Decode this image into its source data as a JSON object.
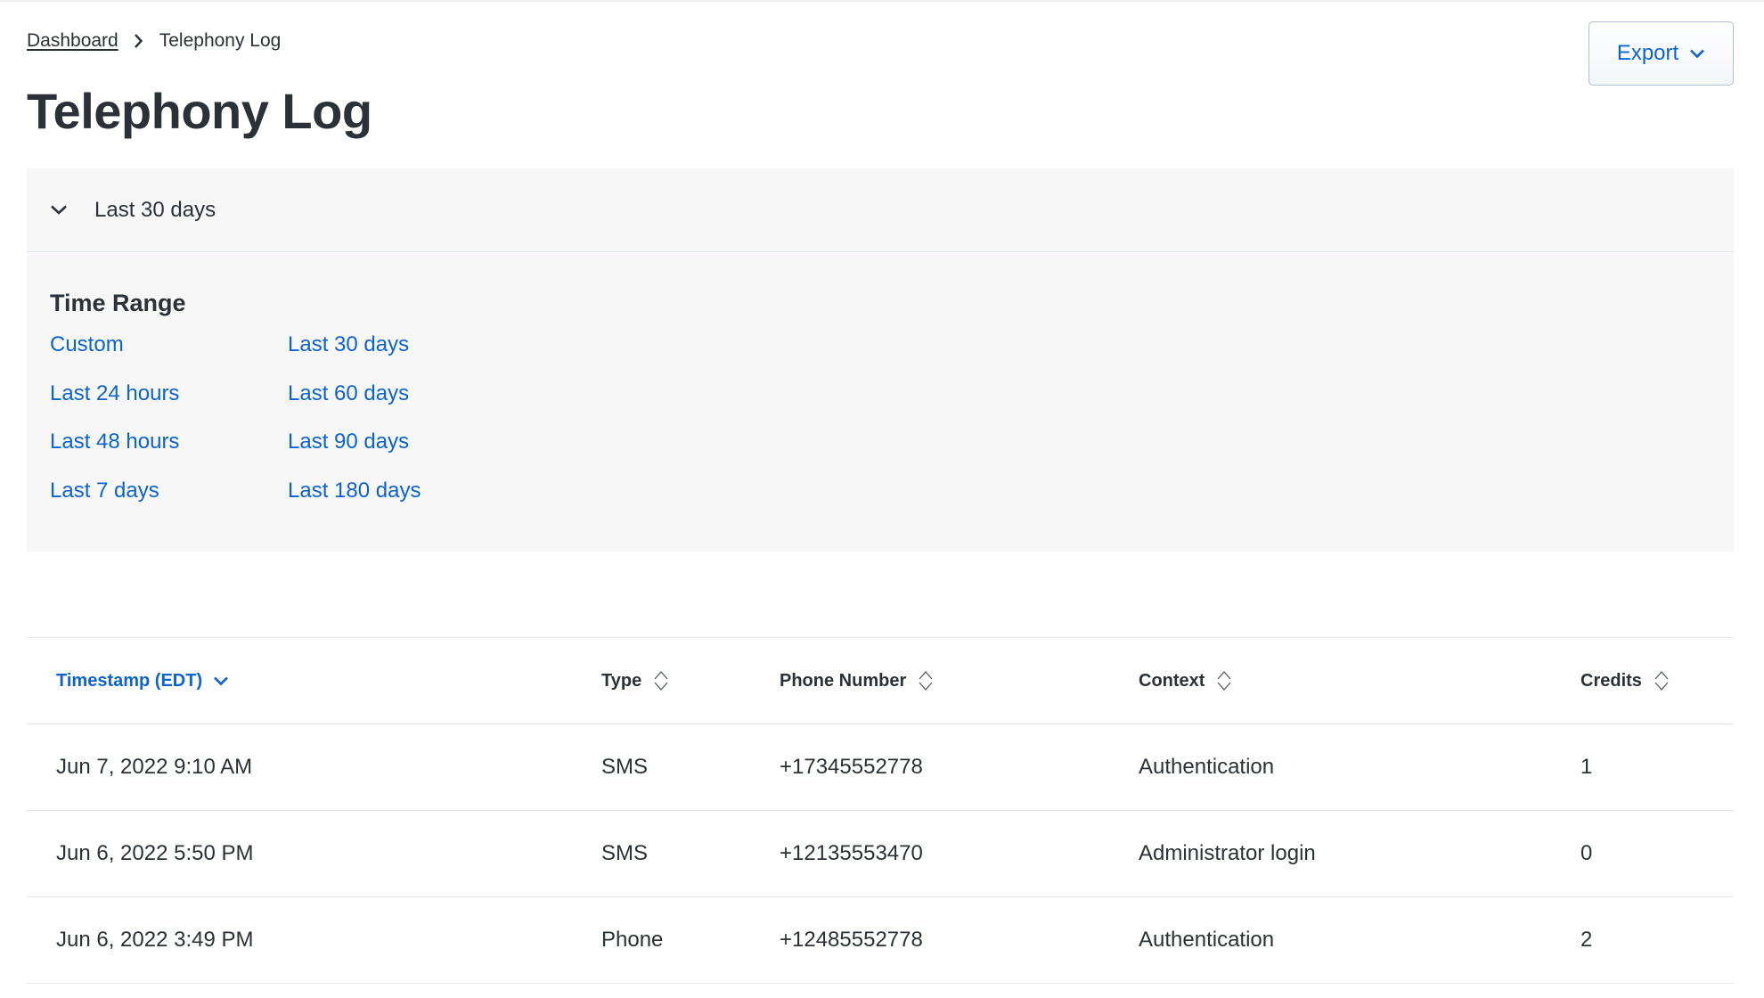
{
  "breadcrumb": {
    "items": [
      {
        "label": "Dashboard"
      },
      {
        "label": "Telephony Log"
      }
    ]
  },
  "page_title": "Telephony Log",
  "export_button": {
    "label": "Export",
    "icon": "chevron-down-icon"
  },
  "filter": {
    "selected_label": "Last 30 days",
    "expanded": true,
    "section_title": "Time Range",
    "options": [
      "Custom",
      "Last 30 days",
      "Last 24 hours",
      "Last 60 days",
      "Last 48 hours",
      "Last 90 days",
      "Last 7 days",
      "Last 180 days"
    ]
  },
  "table": {
    "columns": [
      {
        "label": "Timestamp (EDT)",
        "sort": "descending",
        "active": true
      },
      {
        "label": "Type",
        "sort": "none"
      },
      {
        "label": "Phone Number",
        "sort": "none"
      },
      {
        "label": "Context",
        "sort": "none"
      },
      {
        "label": "Credits",
        "sort": "none"
      }
    ],
    "rows": [
      [
        "Jun 7, 2022 9:10 AM",
        "SMS",
        "+17345552778",
        "Authentication",
        "1"
      ],
      [
        "Jun 6, 2022 5:50 PM",
        "SMS",
        "+12135553470",
        "Administrator login",
        "0"
      ],
      [
        "Jun 6, 2022 3:49 PM",
        "Phone",
        "+12485552778",
        "Authentication",
        "2"
      ]
    ]
  },
  "colors": {
    "accent": "#0b63d6",
    "text": "#2b3136",
    "panel_bg": "#f7f7f8",
    "border": "#dfe5ec"
  }
}
